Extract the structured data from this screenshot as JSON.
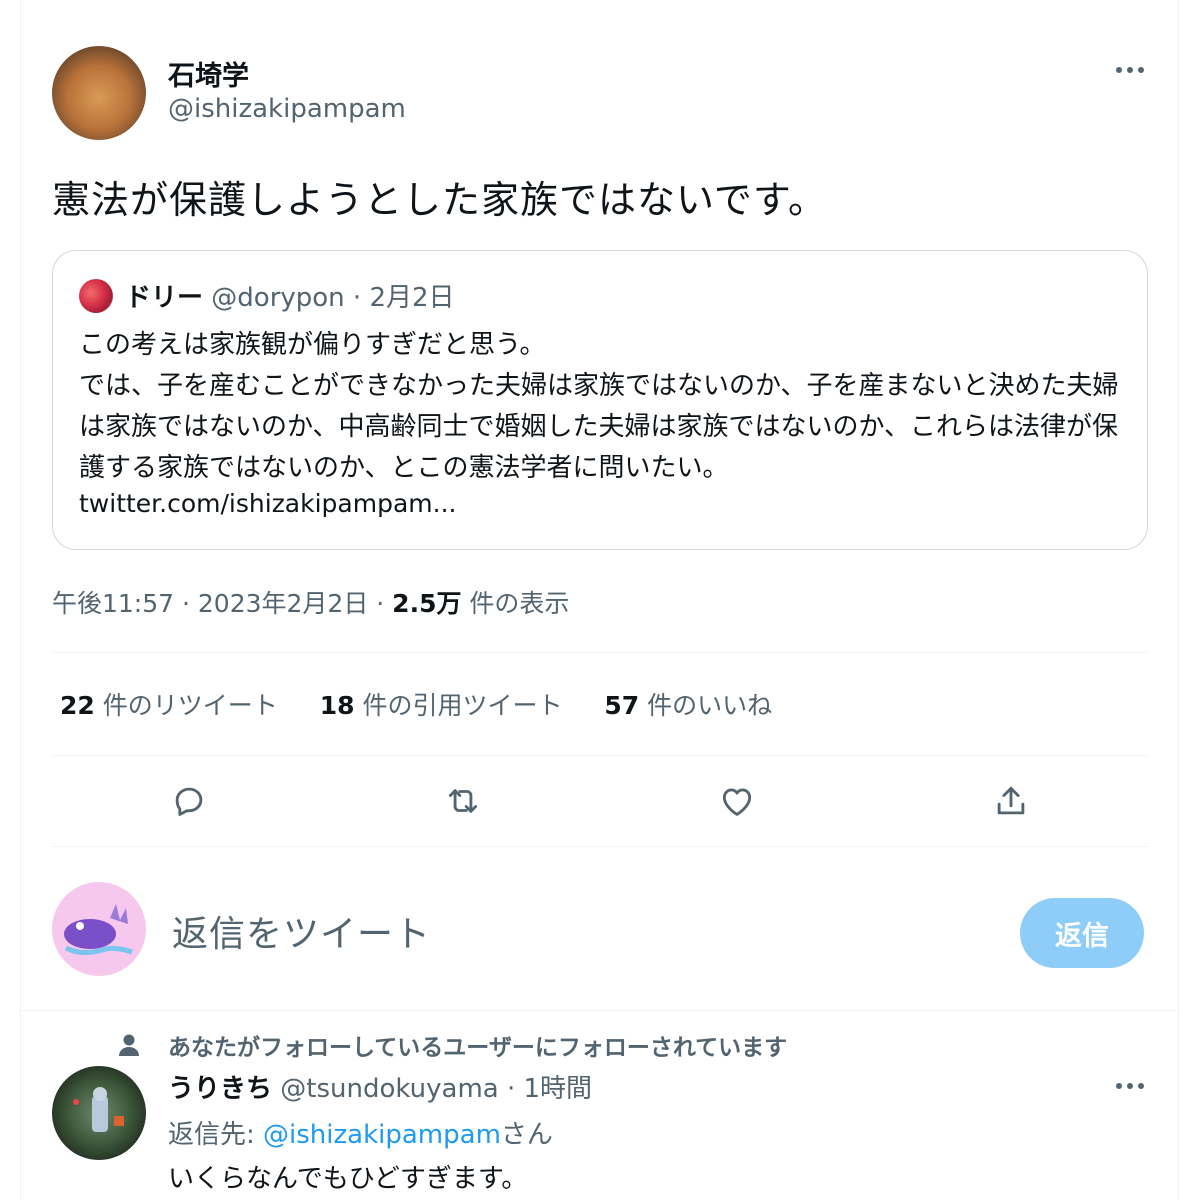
{
  "tweet": {
    "author_name": "石埼学",
    "author_handle": "@ishizakipampam",
    "text": "憲法が保護しようとした家族ではないです。",
    "timestamp": "午後11:57 · 2023年2月2日 · ",
    "views_count": "2.5万",
    "views_label": " 件の表示"
  },
  "quote": {
    "name": "ドリー",
    "meta": " @dorypon · 2月2日",
    "body": "この考えは家族観が偏りすぎだと思う。\nでは、子を産むことができなかった夫婦は家族ではないのか、子を産まないと決めた夫婦は家族ではないのか、中高齢同士で婚姻した夫婦は家族ではないのか、これらは法律が保護する家族ではないのか、とこの憲法学者に問いたい。",
    "link": "twitter.com/ishizakipampam..."
  },
  "stats": {
    "retweets_count": "22",
    "retweets_label": " 件のリツイート",
    "quotes_count": "18",
    "quotes_label": " 件の引用ツイート",
    "likes_count": "57",
    "likes_label": " 件のいいね"
  },
  "reply_box": {
    "placeholder": "返信をツイート",
    "button_label": "返信"
  },
  "reply": {
    "social_context": "あなたがフォローしているユーザーにフォローされています",
    "name": "うりきち",
    "meta": " @tsundokuyama · 1時間",
    "reply_to_prefix": "返信先: ",
    "reply_to_handle": "@ishizakipampam",
    "reply_to_suffix": "さん",
    "text": "いくらなんでもひどすぎます。"
  },
  "colors": {
    "primary_text": "#0f1419",
    "secondary_text": "#536471",
    "accent": "#1d9bf0",
    "reply_button_disabled": "#8ecdf8"
  },
  "icons": [
    "more-icon",
    "reply-icon",
    "retweet-icon",
    "like-icon",
    "share-icon",
    "person-icon"
  ]
}
